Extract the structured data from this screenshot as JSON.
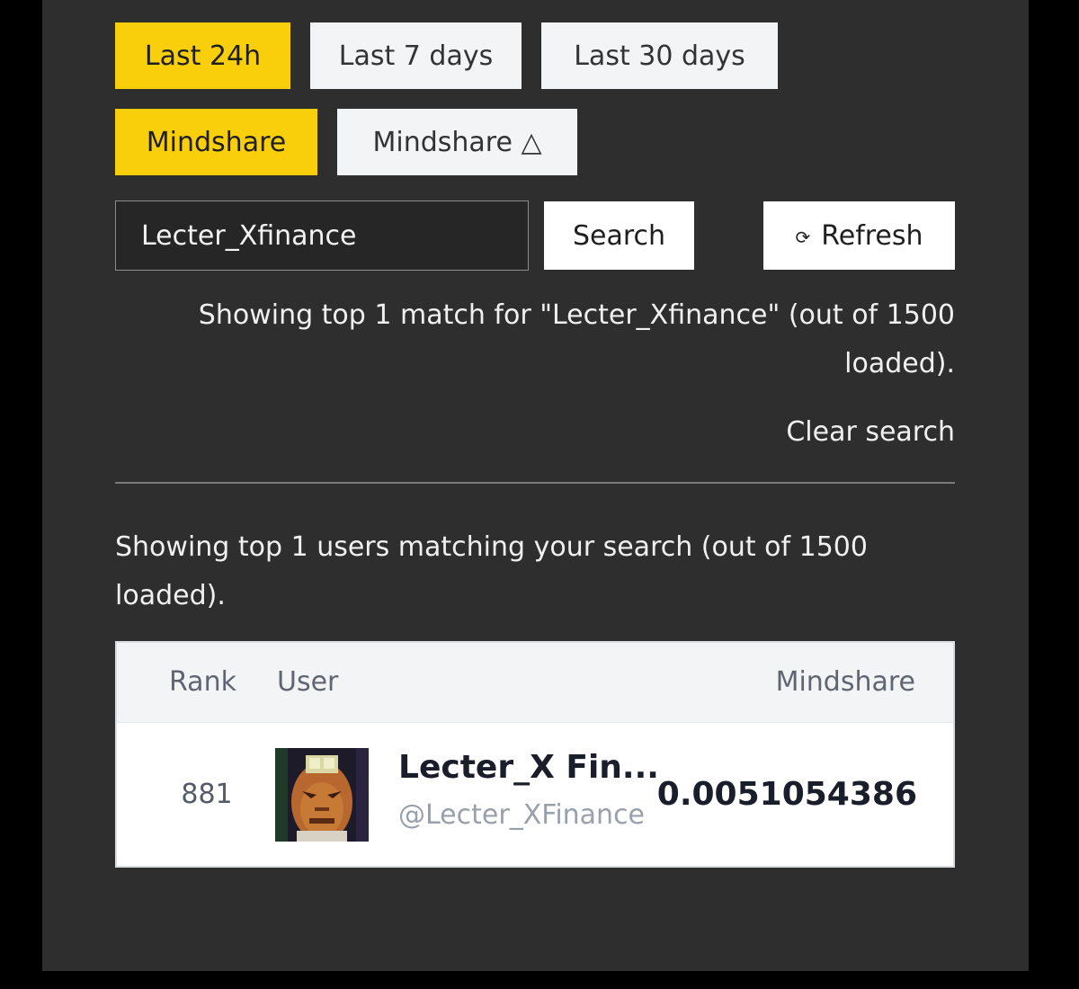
{
  "time_filters": [
    {
      "label": "Last 24h",
      "active": true
    },
    {
      "label": "Last 7 days",
      "active": false
    },
    {
      "label": "Last 30 days",
      "active": false
    }
  ],
  "metric_filters": [
    {
      "label": "Mindshare",
      "active": true
    },
    {
      "label": "Mindshare △",
      "active": false
    }
  ],
  "search": {
    "value": "Lecter_Xfinance",
    "button_label": "Search",
    "refresh_icon": "⟳",
    "refresh_label": "Refresh"
  },
  "status": {
    "match_text": "Showing top 1 match for \"Lecter_Xfinance\" (out of 1500 loaded).",
    "clear_label": "Clear search"
  },
  "summary_text": "Showing top 1 users matching your search (out of 1500 loaded).",
  "table": {
    "headers": {
      "rank": "Rank",
      "user": "User",
      "mindshare": "Mindshare"
    },
    "rows": [
      {
        "rank": "881",
        "avatar": "user-avatar-icon",
        "name": "Lecter_X Fin...",
        "handle": "@Lecter_XFinance",
        "mindshare": "0.0051054386"
      }
    ]
  },
  "colors": {
    "accent": "#f9cf0c",
    "panel_bg": "#2e2e2e",
    "page_bg": "#000000"
  }
}
